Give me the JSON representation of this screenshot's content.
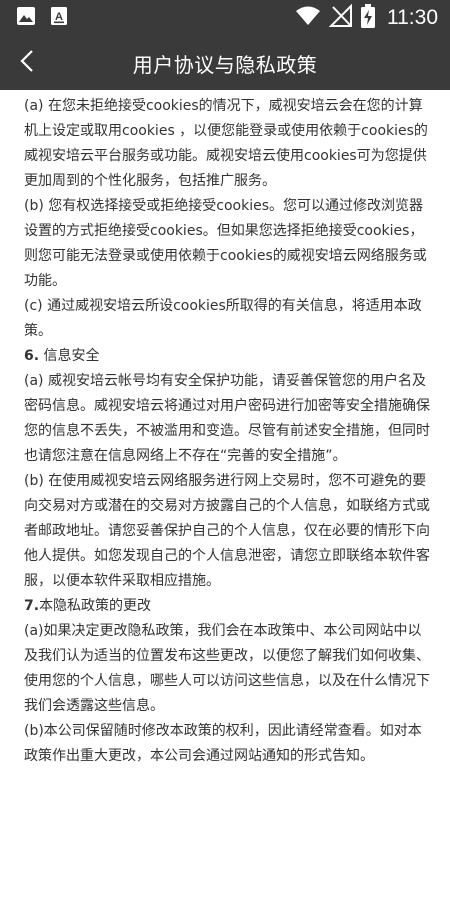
{
  "status_bar": {
    "time": "11:30",
    "icons": [
      "image-icon",
      "text-app-icon",
      "wifi-icon",
      "no-signal-icon",
      "battery-charging-icon"
    ]
  },
  "app_bar": {
    "title": "用户协议与隐私政策",
    "back_icon": "back-arrow-icon"
  },
  "content": {
    "cookies_a": "(a) 在您未拒绝接受cookies的情况下，威视安培云会在您的计算机上设定或取用cookies ，以便您能登录或使用依赖于cookies的威视安培云平台服务或功能。威视安培云使用cookies可为您提供更加周到的个性化服务，包括推广服务。",
    "cookies_b": "(b) 您有权选择接受或拒绝接受cookies。您可以通过修改浏览器设置的方式拒绝接受cookies。但如果您选择拒绝接受cookies，则您可能无法登录或使用依赖于cookies的威视安培云网络服务或功能。",
    "cookies_c": "(c) 通过威视安培云所设cookies所取得的有关信息，将适用本政策。",
    "section6_num": "6.",
    "section6_title": " 信息安全",
    "security_a": "(a) 威视安培云帐号均有安全保护功能，请妥善保管您的用户名及密码信息。威视安培云将通过对用户密码进行加密等安全措施确保您的信息不丢失，不被滥用和变造。尽管有前述安全措施，但同时也请您注意在信息网络上不存在“完善的安全措施”。",
    "security_b": "(b) 在使用威视安培云网络服务进行网上交易时，您不可避免的要向交易对方或潜在的交易对方披露自己的个人信息，如联络方式或者邮政地址。请您妥善保护自己的个人信息，仅在必要的情形下向他人提供。如您发现自己的个人信息泄密，请您立即联络本软件客服，以便本软件采取相应措施。",
    "section7_num": "7.",
    "section7_title": "本隐私政策的更改",
    "change_a": "(a)如果决定更改隐私政策，我们会在本政策中、本公司网站中以及我们认为适当的位置发布这些更改，以便您了解我们如何收集、使用您的个人信息，哪些人可以访问这些信息，以及在什么情况下我们会透露这些信息。",
    "change_b": "(b)本公司保留随时修改本政策的权利，因此请经常查看。如对本政策作出重大更改，本公司会通过网站通知的形式告知。"
  }
}
